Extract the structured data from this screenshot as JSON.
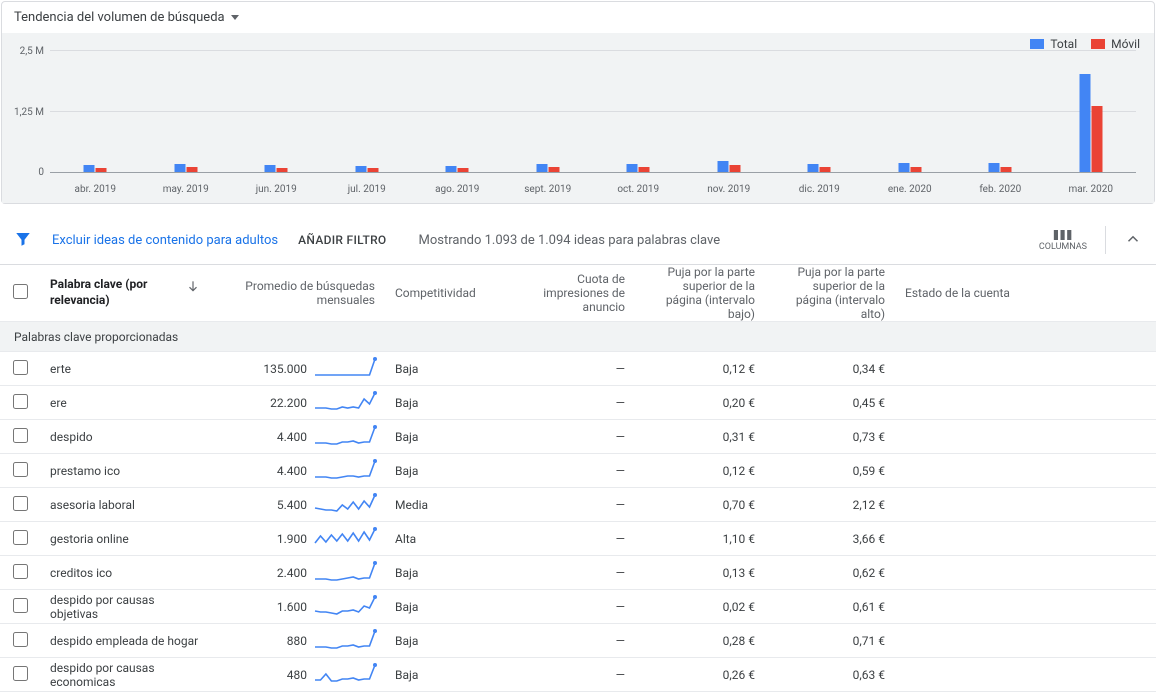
{
  "chart": {
    "title": "Tendencia del volumen de búsqueda",
    "legend": {
      "total": "Total",
      "mobile": "Móvil"
    },
    "y_ticks": [
      "0",
      "1,25 M",
      "2,5 M"
    ]
  },
  "chart_data": {
    "type": "bar",
    "ylabel": "",
    "xlabel": "",
    "ylim": [
      0,
      2500000
    ],
    "categories": [
      "abr. 2019",
      "may. 2019",
      "jun. 2019",
      "jul. 2019",
      "ago. 2019",
      "sept. 2019",
      "oct. 2019",
      "nov. 2019",
      "dic. 2019",
      "ene. 2020",
      "feb. 2020",
      "mar. 2020"
    ],
    "series": [
      {
        "name": "Total",
        "color": "#4285f4",
        "values": [
          150000,
          160000,
          150000,
          130000,
          120000,
          170000,
          160000,
          220000,
          170000,
          180000,
          180000,
          2000000
        ]
      },
      {
        "name": "Móvil",
        "color": "#ea4335",
        "values": [
          90000,
          95000,
          90000,
          80000,
          75000,
          100000,
          100000,
          140000,
          110000,
          110000,
          110000,
          1350000
        ]
      }
    ]
  },
  "toolbar": {
    "exclude_adult": "Excluir ideas de contenido para adultos",
    "add_filter": "AÑADIR FILTRO",
    "showing": "Mostrando 1.093 de 1.094 ideas para palabras clave",
    "columns": "COLUMNAS"
  },
  "headers": {
    "keyword": "Palabra clave (por relevancia)",
    "avg_searches": "Promedio de búsquedas mensuales",
    "competition": "Competitividad",
    "impression_share": "Cuota de impresiones de anuncio",
    "low_bid": "Puja por la parte superior de la página (intervalo bajo)",
    "high_bid": "Puja por la parte superior de la página (intervalo alto)",
    "account_status": "Estado de la cuenta"
  },
  "section_label": "Palabras clave proporcionadas",
  "rows": [
    {
      "keyword": "erte",
      "avg": "135.000",
      "spark": [
        4,
        4,
        4,
        4,
        4,
        4,
        4,
        4,
        4,
        4,
        4,
        20
      ],
      "competition": "Baja",
      "share": "—",
      "low": "0,12 €",
      "high": "0,34 €"
    },
    {
      "keyword": "ere",
      "avg": "22.200",
      "spark": [
        5,
        5,
        5,
        4,
        4,
        6,
        5,
        6,
        5,
        14,
        9,
        20
      ],
      "competition": "Baja",
      "share": "—",
      "low": "0,20 €",
      "high": "0,45 €"
    },
    {
      "keyword": "despido",
      "avg": "4.400",
      "spark": [
        4,
        4,
        4,
        3,
        3,
        5,
        5,
        6,
        4,
        5,
        5,
        20
      ],
      "competition": "Baja",
      "share": "—",
      "low": "0,31 €",
      "high": "0,73 €"
    },
    {
      "keyword": "prestamo ico",
      "avg": "4.400",
      "spark": [
        4,
        4,
        4,
        3,
        3,
        4,
        5,
        5,
        4,
        5,
        5,
        20
      ],
      "competition": "Baja",
      "share": "—",
      "low": "0,12 €",
      "high": "0,59 €"
    },
    {
      "keyword": "asesoria laboral",
      "avg": "5.400",
      "spark": [
        7,
        6,
        5,
        5,
        4,
        10,
        6,
        13,
        6,
        14,
        8,
        20
      ],
      "competition": "Media",
      "share": "—",
      "low": "0,70 €",
      "high": "2,12 €"
    },
    {
      "keyword": "gestoria online",
      "avg": "1.900",
      "spark": [
        6,
        13,
        7,
        14,
        8,
        15,
        8,
        16,
        8,
        17,
        9,
        20
      ],
      "competition": "Alta",
      "share": "—",
      "low": "1,10 €",
      "high": "3,66 €"
    },
    {
      "keyword": "creditos ico",
      "avg": "2.400",
      "spark": [
        4,
        4,
        4,
        3,
        3,
        4,
        5,
        6,
        4,
        5,
        5,
        20
      ],
      "competition": "Baja",
      "share": "—",
      "low": "0,13 €",
      "high": "0,62 €"
    },
    {
      "keyword": "despido por causas objetivas",
      "avg": "1.600",
      "spark": [
        6,
        5,
        5,
        4,
        3,
        6,
        6,
        7,
        5,
        11,
        9,
        20
      ],
      "competition": "Baja",
      "share": "—",
      "low": "0,02 €",
      "high": "0,61 €"
    },
    {
      "keyword": "despido empleada de hogar",
      "avg": "880",
      "spark": [
        4,
        4,
        4,
        3,
        3,
        5,
        5,
        6,
        4,
        5,
        5,
        20
      ],
      "competition": "Baja",
      "share": "—",
      "low": "0,28 €",
      "high": "0,71 €"
    },
    {
      "keyword": "despido por causas economicas",
      "avg": "480",
      "spark": [
        5,
        5,
        11,
        4,
        4,
        6,
        6,
        7,
        5,
        6,
        6,
        20
      ],
      "competition": "Baja",
      "share": "—",
      "low": "0,26 €",
      "high": "0,63 €"
    }
  ]
}
